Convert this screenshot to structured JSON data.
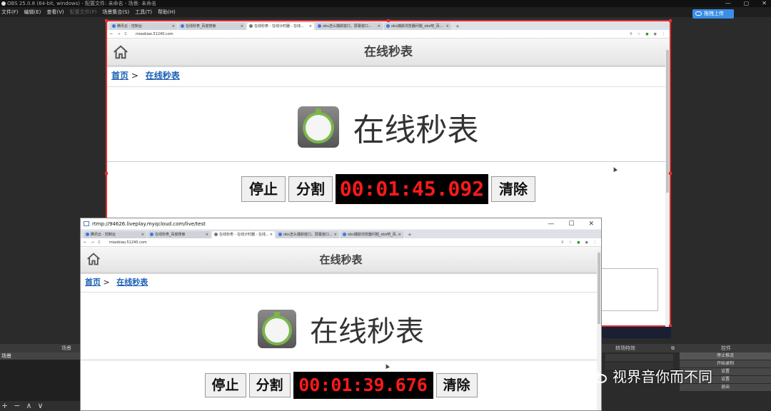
{
  "obs": {
    "title": "OBS 25.0.8 (64-bit, windows) - 配置文件: 未命名 - 场景: 未命名",
    "menu": [
      "文件(F)",
      "编辑(E)",
      "查看(V)",
      "配置文件(P)",
      "场景集合(S)",
      "工具(T)",
      "帮助(H)"
    ],
    "upload_label": "拖拽上传",
    "docks": {
      "scenes": "场景",
      "transitions": "转场特效",
      "controls": "控件"
    },
    "scene_item": "场景",
    "scene_buttons": [
      "+",
      "−",
      "∧",
      "∨"
    ],
    "controls": [
      "停止推流",
      "开始录制",
      "设置",
      "设置",
      "退出"
    ]
  },
  "browser": {
    "tabs": [
      {
        "label": "腾讯云 - 控制台",
        "active": false
      },
      {
        "label": "在线秒表_百度搜索",
        "active": false
      },
      {
        "label": "在线秒表 - 在线计时器 - 在线...",
        "active": true
      },
      {
        "label": "obs怎么捕获窗口、屏幕窗口...",
        "active": false
      },
      {
        "label": "obs捕获浏览器问题_obs吧_百...",
        "active": false
      }
    ],
    "url": "miaobiao.51240.com"
  },
  "site": {
    "header_title": "在线秒表",
    "breadcrumb": {
      "home": "首页",
      "separator": ">",
      "current": "在线秒表"
    },
    "hero_title": "在线秒表",
    "buttons": {
      "stop": "停止",
      "split": "分割",
      "clear": "清除"
    }
  },
  "timers": {
    "source": "00:01:45.092",
    "stream": "00:01:39.676"
  },
  "player": {
    "window_title": "rtmp://94626.liveplay.myqcloud.com/live/test"
  },
  "watermark": {
    "text": "视界音你而不同"
  },
  "colors": {
    "selection": "#e03030",
    "timer_text": "#ff1a1a",
    "link": "#1a5fb4",
    "upload": "#3a8ee6"
  }
}
